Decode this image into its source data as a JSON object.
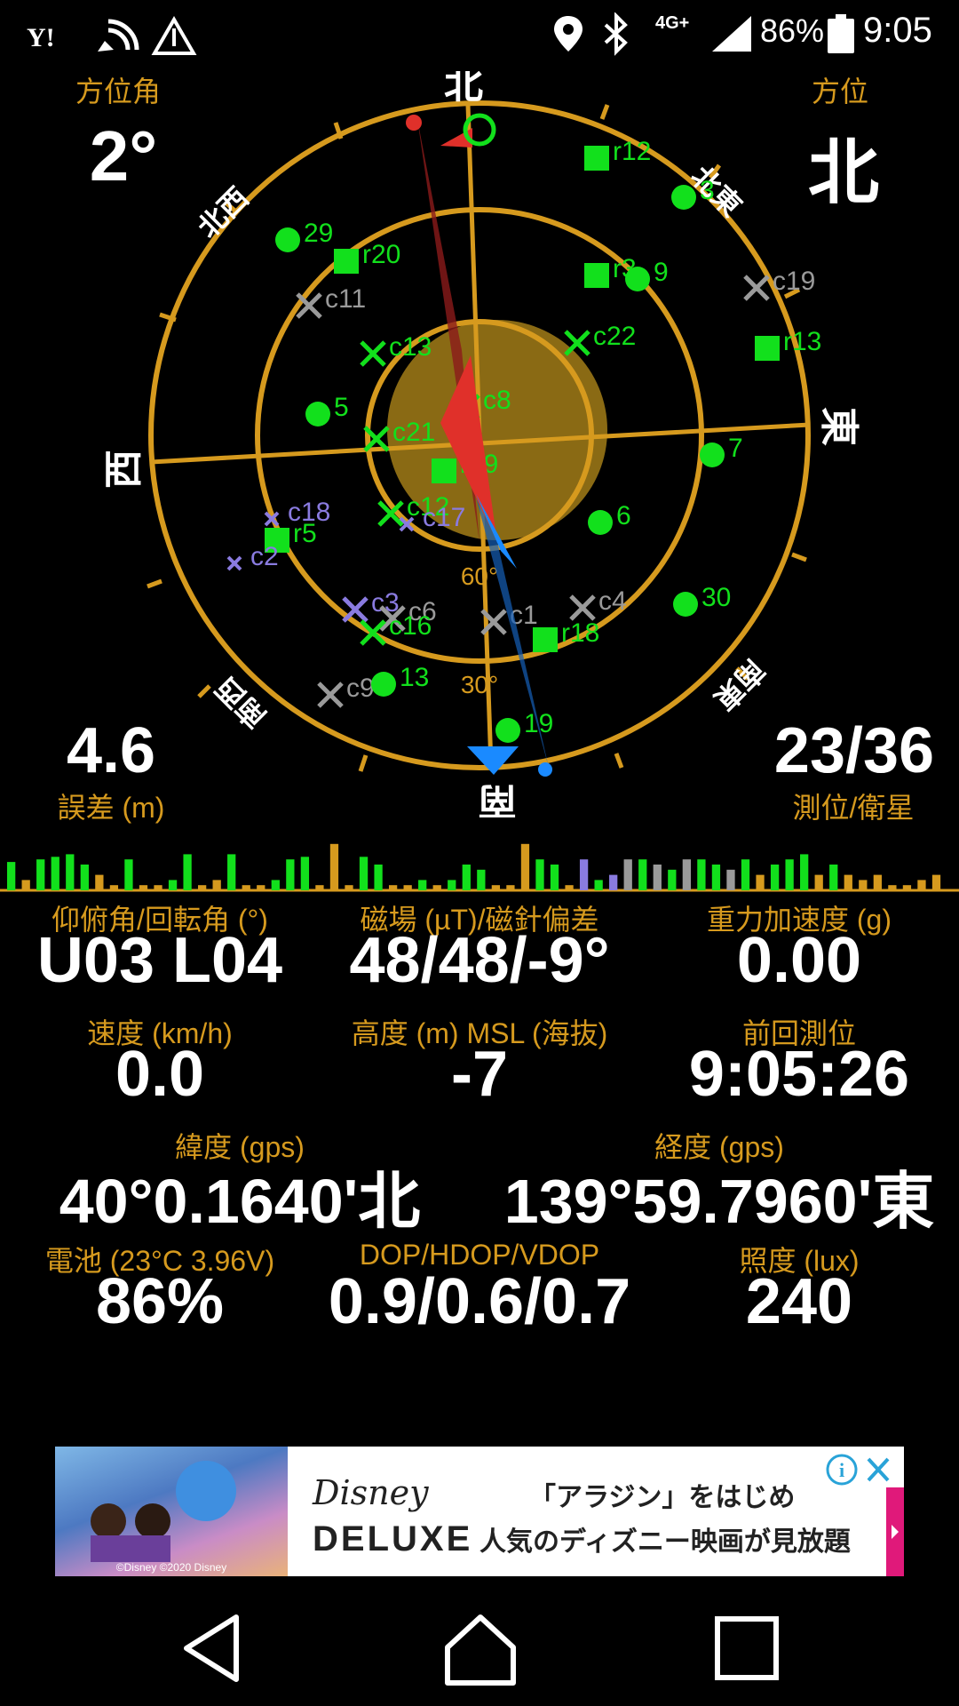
{
  "status_bar": {
    "carrier_icon": "yahoo-icon",
    "battery_percent": "86%",
    "time": "9:05",
    "network": "4G+"
  },
  "top": {
    "azimuth_label": "方位角",
    "azimuth_value": "2°",
    "direction_label": "方位",
    "direction_value": "北",
    "error_value": "4.6",
    "error_label": "誤差 (m)",
    "sats_value": "23/36",
    "sats_label": "測位/衛星"
  },
  "radar": {
    "compass": {
      "north": "北",
      "south": "南",
      "east": "東",
      "west": "西",
      "ne": "北東",
      "nw": "北西",
      "se": "南東",
      "sw": "南西"
    },
    "elev_labels": [
      "60°",
      "30°"
    ],
    "satellites": [
      {
        "label": "r12",
        "shape": "square",
        "color": "#12e01c"
      },
      {
        "label": "3",
        "shape": "dot",
        "color": "#12e01c"
      },
      {
        "label": "29",
        "shape": "dot",
        "color": "#12e01c"
      },
      {
        "label": "r20",
        "shape": "square",
        "color": "#12e01c"
      },
      {
        "label": "r3",
        "shape": "square",
        "color": "#12e01c"
      },
      {
        "label": "9",
        "shape": "dot",
        "color": "#12e01c"
      },
      {
        "label": "c19",
        "shape": "x",
        "color": "#9a9a9a"
      },
      {
        "label": "c11",
        "shape": "x",
        "color": "#9a9a9a"
      },
      {
        "label": "r13",
        "shape": "square",
        "color": "#12e01c"
      },
      {
        "label": "c22",
        "shape": "x",
        "color": "#12e01c"
      },
      {
        "label": "c13",
        "shape": "x",
        "color": "#12e01c"
      },
      {
        "label": "5",
        "shape": "dot",
        "color": "#12e01c"
      },
      {
        "label": "c8",
        "shape": "x",
        "color": "#12e01c"
      },
      {
        "label": "c21",
        "shape": "x",
        "color": "#12e01c"
      },
      {
        "label": "7",
        "shape": "dot",
        "color": "#12e01c"
      },
      {
        "label": "r19",
        "shape": "square",
        "color": "#12e01c"
      },
      {
        "label": "c18",
        "shape": "xs",
        "color": "#8a7be0"
      },
      {
        "label": "c12",
        "shape": "x",
        "color": "#12e01c"
      },
      {
        "label": "c17",
        "shape": "xs",
        "color": "#8a7be0"
      },
      {
        "label": "6",
        "shape": "dot",
        "color": "#12e01c"
      },
      {
        "label": "r5",
        "shape": "square",
        "color": "#12e01c"
      },
      {
        "label": "c2",
        "shape": "xs",
        "color": "#8a7be0"
      },
      {
        "label": "c3",
        "shape": "x",
        "color": "#8a7be0"
      },
      {
        "label": "c6",
        "shape": "x",
        "color": "#9a9a9a"
      },
      {
        "label": "c16",
        "shape": "x",
        "color": "#12e01c"
      },
      {
        "label": "c1",
        "shape": "x",
        "color": "#9a9a9a"
      },
      {
        "label": "c4",
        "shape": "x",
        "color": "#9a9a9a"
      },
      {
        "label": "30",
        "shape": "dot",
        "color": "#12e01c"
      },
      {
        "label": "r18",
        "shape": "square",
        "color": "#12e01c"
      },
      {
        "label": "c9",
        "shape": "x",
        "color": "#9a9a9a"
      },
      {
        "label": "13",
        "shape": "dot",
        "color": "#12e01c"
      },
      {
        "label": "19",
        "shape": "dot",
        "color": "#12e01c"
      }
    ]
  },
  "signal_bars": {
    "levels": [
      0.55,
      0.2,
      0.6,
      0.65,
      0.7,
      0.5,
      0.3,
      0.1,
      0.6,
      0.1,
      0.1,
      0.2,
      0.7,
      0.1,
      0.2,
      0.7,
      0.1,
      0.1,
      0.2,
      0.6,
      0.65,
      0.1,
      0.9,
      0.1,
      0.65,
      0.5,
      0.1,
      0.1,
      0.2,
      0.1,
      0.2,
      0.5,
      0.4,
      0.1,
      0.1,
      0.9,
      0.6,
      0.5,
      0.1,
      0.6,
      0.2,
      0.3,
      0.6,
      0.6,
      0.5,
      0.4,
      0.6,
      0.6,
      0.5,
      0.4,
      0.6,
      0.3,
      0.5,
      0.6,
      0.7,
      0.3,
      0.5,
      0.3,
      0.2,
      0.3,
      0.1,
      0.1,
      0.2,
      0.3
    ],
    "colors": [
      "#12e01c",
      "#d69a1e",
      "#12e01c",
      "#12e01c",
      "#12e01c",
      "#12e01c",
      "#d69a1e",
      "#d69a1e",
      "#12e01c",
      "#d69a1e",
      "#d69a1e",
      "#12e01c",
      "#12e01c",
      "#d69a1e",
      "#d69a1e",
      "#12e01c",
      "#d69a1e",
      "#d69a1e",
      "#12e01c",
      "#12e01c",
      "#12e01c",
      "#d69a1e",
      "#d69a1e",
      "#d69a1e",
      "#12e01c",
      "#12e01c",
      "#d69a1e",
      "#d69a1e",
      "#12e01c",
      "#d69a1e",
      "#12e01c",
      "#12e01c",
      "#12e01c",
      "#d69a1e",
      "#d69a1e",
      "#d69a1e",
      "#12e01c",
      "#12e01c",
      "#d69a1e",
      "#8a7be0",
      "#12e01c",
      "#8a7be0",
      "#9a9a9a",
      "#12e01c",
      "#9a9a9a",
      "#12e01c",
      "#9a9a9a",
      "#12e01c",
      "#12e01c",
      "#9a9a9a",
      "#12e01c",
      "#d69a1e",
      "#12e01c",
      "#12e01c",
      "#12e01c",
      "#d69a1e",
      "#12e01c",
      "#d69a1e",
      "#d69a1e",
      "#d69a1e",
      "#d69a1e",
      "#d69a1e",
      "#d69a1e",
      "#d69a1e"
    ]
  },
  "stats": {
    "pitch_roll_label": "仰俯角/回転角 (°)",
    "pitch_roll_value": "U03 L04",
    "mag_label": "磁場 (µT)/磁針偏差",
    "mag_value": "48/48/-9°",
    "gravity_label": "重力加速度 (g)",
    "gravity_value": "0.00",
    "speed_label": "速度 (km/h)",
    "speed_value": "0.0",
    "altitude_label": "高度 (m) MSL (海抜)",
    "altitude_value": "-7",
    "last_fix_label": "前回測位",
    "last_fix_value": "9:05:26",
    "lat_label": "緯度 (gps)",
    "lat_value": "40°0.1640'北",
    "lon_label": "経度 (gps)",
    "lon_value": "139°59.7960'東",
    "battery_label": "電池 (23°C 3.96V)",
    "battery_value": "86%",
    "dop_label": "DOP/HDOP/VDOP",
    "dop_value": "0.9/0.6/0.7",
    "lux_label": "照度 (lux)",
    "lux_value": "240"
  },
  "ad": {
    "brand_line1": "Disney",
    "brand_line2": "DELUXE",
    "text_line1": "「アラジン」をはじめ",
    "text_line2": "人気のディズニー映画が見放題",
    "image_caption": "©Disney ©2020 Disney"
  },
  "nav": {
    "back": "back-icon",
    "home": "home-icon",
    "recents": "recents-icon"
  }
}
